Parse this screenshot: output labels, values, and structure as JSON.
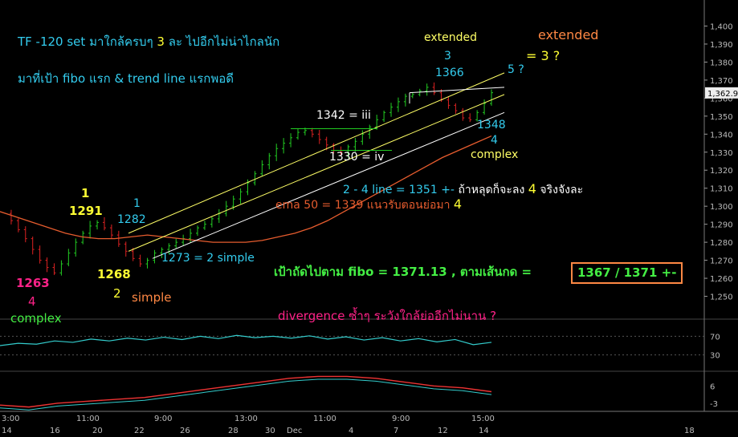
{
  "chart_data": {
    "type": "candlestick",
    "ylim": [
      1240,
      1410
    ],
    "y_ticks": [
      "1,400",
      "1,390",
      "1,380",
      "1,370",
      "1,360",
      "1,350",
      "1,340",
      "1,330",
      "1,320",
      "1,310",
      "1,300",
      "1,290",
      "1,280",
      "1,270",
      "1,260",
      "1,250"
    ],
    "last_price": "1,362.9",
    "rsi_ticks": [
      "70",
      "30"
    ],
    "macd_ticks": [
      "6",
      "-3"
    ],
    "x_time_labels": [
      "3:00",
      "11:00",
      "9:00",
      "13:00",
      "11:00",
      "9:00",
      "15:00"
    ],
    "x_date_labels": [
      "14",
      "16",
      "20",
      "22",
      "26",
      "28",
      "30",
      "Dec",
      "4",
      "7",
      "12",
      "14",
      "18"
    ],
    "price_path": [
      1296,
      1292,
      1287,
      1282,
      1276,
      1270,
      1266,
      1263,
      1268,
      1274,
      1280,
      1285,
      1289,
      1291,
      1288,
      1284,
      1279,
      1275,
      1271,
      1268,
      1270,
      1274,
      1276,
      1278,
      1280,
      1282,
      1285,
      1288,
      1290,
      1293,
      1296,
      1300,
      1304,
      1308,
      1313,
      1318,
      1323,
      1328,
      1332,
      1335,
      1338,
      1341,
      1342,
      1340,
      1337,
      1334,
      1331,
      1330,
      1333,
      1336,
      1340,
      1344,
      1348,
      1352,
      1355,
      1358,
      1361,
      1362,
      1364,
      1366,
      1363,
      1359,
      1356,
      1353,
      1349,
      1348,
      1352,
      1357,
      1363
    ],
    "ema50_path": [
      1297,
      1294,
      1291,
      1288,
      1285,
      1283,
      1282,
      1282,
      1283,
      1284,
      1283,
      1282,
      1281,
      1280,
      1280,
      1280,
      1281,
      1283,
      1285,
      1288,
      1292,
      1297,
      1302,
      1307,
      1312,
      1317,
      1322,
      1327,
      1331,
      1335,
      1339
    ],
    "rsi_path": [
      50,
      55,
      53,
      60,
      57,
      64,
      60,
      66,
      62,
      68,
      63,
      70,
      65,
      72,
      67,
      70,
      66,
      71,
      64,
      69,
      62,
      67,
      60,
      65,
      58,
      63,
      52,
      57
    ],
    "macd_path": [
      -4,
      -5,
      -3,
      -2,
      -1,
      0,
      2,
      4,
      6,
      8,
      10,
      11,
      11,
      10,
      8,
      6,
      5,
      3
    ],
    "annotations": {
      "header_line1": "TF  -120 set มาใกล้ครบๆ",
      "header_line1_num": "3",
      "header_line1_tail": "ละ  ไปอีกไม่น่าไกลนัก",
      "header_line2": "มาที่เป้า fibo แรก & trend line แรกพอดี",
      "extended_left": "extended",
      "extended_left_num": "3",
      "label_1366": "1366",
      "label_five": "5 ?",
      "extended_right": "extended",
      "extended_right_eq": "= 3 ?",
      "label_1342": "1342 = iii",
      "label_1330": "1330 = iv",
      "label_1348": "1348",
      "label_4_right": "4",
      "complex_right": "complex",
      "trendline_note": "2 - 4  line = 1351 +-",
      "trendline_note_thai": "ถ้าหลุดก็จะลง",
      "trendline_note_num": "4",
      "trendline_note_tail": "จริงจังละ",
      "ema_note": "ema 50 = 1339  แนวรับตอนย่อมา",
      "ema_note_num": "4",
      "label_1_top": "1",
      "label_1291": "1291",
      "label_1_blue": "1",
      "label_1282": "1282",
      "label_1273": "1273 = 2  simple",
      "label_1268": "1268",
      "label_2": "2",
      "simple_left": "simple",
      "label_1263": "1263",
      "label_4_left": "4",
      "complex_left": "complex",
      "fibo_target": "เป้าถัดไปตาม fibo =  1371.13  , ตามเส้นกด =",
      "target_box": "1367 / 1371 +-",
      "divergence": "divergence ซ้ำๆ ระวังใกล้ย่ออีกไม่นาน ?"
    },
    "colors": {
      "background": "#000000",
      "up_candle": "#22cc22",
      "down_candle": "#dd2222",
      "ema": "#e65c2e",
      "channel": "#ffff66",
      "trendline": "#ffffff",
      "rsi": "#33cccc",
      "macd_red": "#ee3333",
      "cyan_text": "#33ccee",
      "yellow_text": "#ffff33",
      "green_text": "#44ee44",
      "orange_text": "#ff8844",
      "pink_text": "#ff2288"
    }
  }
}
